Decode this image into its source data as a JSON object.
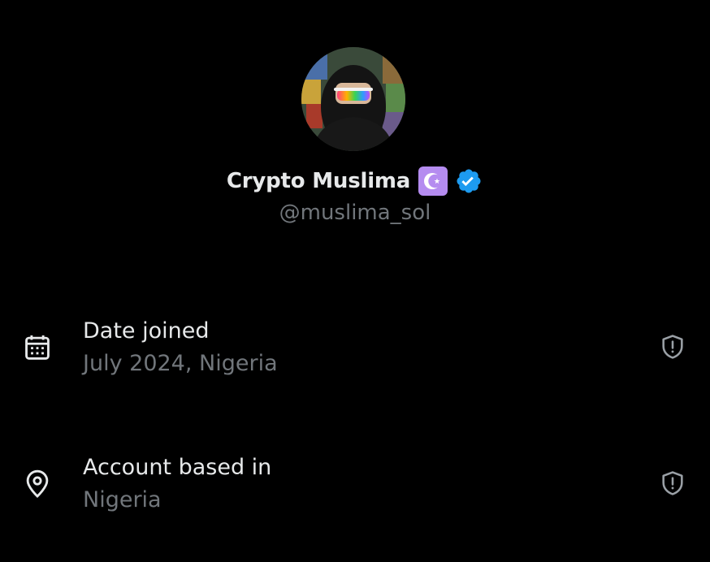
{
  "profile": {
    "display_name": "Crypto Muslima",
    "handle": "@muslima_sol",
    "avatar_icon": "avatar-image",
    "emoji_badge": "star-and-crescent",
    "verified": true,
    "verified_color": "#1d9bf0"
  },
  "details": [
    {
      "title": "Date joined",
      "value": "July 2024, Nigeria",
      "icon": "calendar-icon",
      "action_icon": "shield-alert-icon"
    },
    {
      "title": "Account based in",
      "value": "Nigeria",
      "icon": "location-pin-icon",
      "action_icon": "shield-alert-icon"
    }
  ],
  "colors": {
    "background": "#000000",
    "primary_text": "#e7e9ea",
    "secondary_text": "#71767b",
    "badge_purple": "#b58cf0"
  }
}
